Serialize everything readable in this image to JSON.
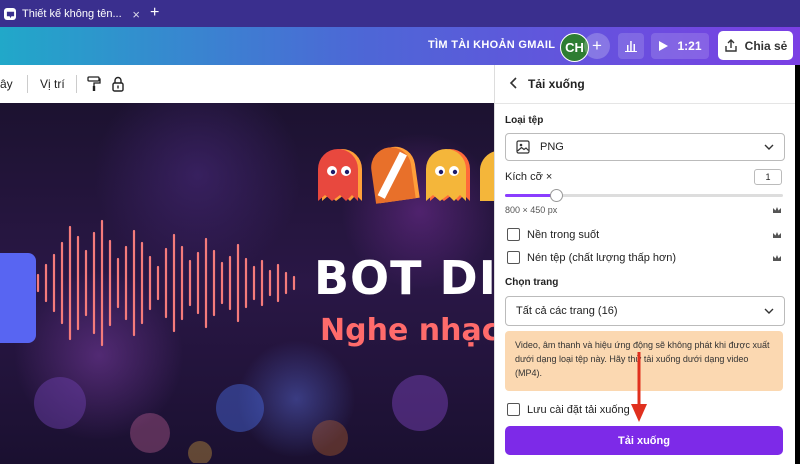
{
  "browser": {
    "tab_title": "Thiết kế không tên...",
    "close": "×",
    "new_tab": "+"
  },
  "appbar": {
    "upgrade_label": "TÌM TÀI KHOẢN GMAIL",
    "avatar_initials": "CH",
    "add_label": "+",
    "duration": "1:21",
    "share_label": "Chia sẻ",
    "gradient": [
      "#21a8c9",
      "#7b3fe4"
    ]
  },
  "toolbar": {
    "items": [
      "ây",
      "Vị trí"
    ]
  },
  "canvas": {
    "headline": "BOT DIS",
    "subline": "Nghe nhạc"
  },
  "panel": {
    "title": "Tải xuống",
    "file_type_label": "Loại tệp",
    "file_type_value": "PNG",
    "size_label": "Kích cỡ ×",
    "size_value": "1",
    "size_fraction": 0.18,
    "dimensions": "800 × 450 px",
    "options": [
      {
        "label": "Nền trong suốt",
        "checked": false
      },
      {
        "label": "Nén tệp (chất lượng thấp hơn)",
        "checked": false
      }
    ],
    "pages_label": "Chọn trang",
    "pages_value": "Tất cả các trang (16)",
    "notice": "Video, âm thanh và hiệu ứng động sẽ không phát khi được xuất dưới dạng loại tệp này. Hãy thử tải xuống dưới dạng video (MP4).",
    "save_settings_label": "Lưu cài đặt tải xuống",
    "download_button": "Tải xuống",
    "accent": "#7d2ae8",
    "notice_bg": "#fbd8b1"
  }
}
